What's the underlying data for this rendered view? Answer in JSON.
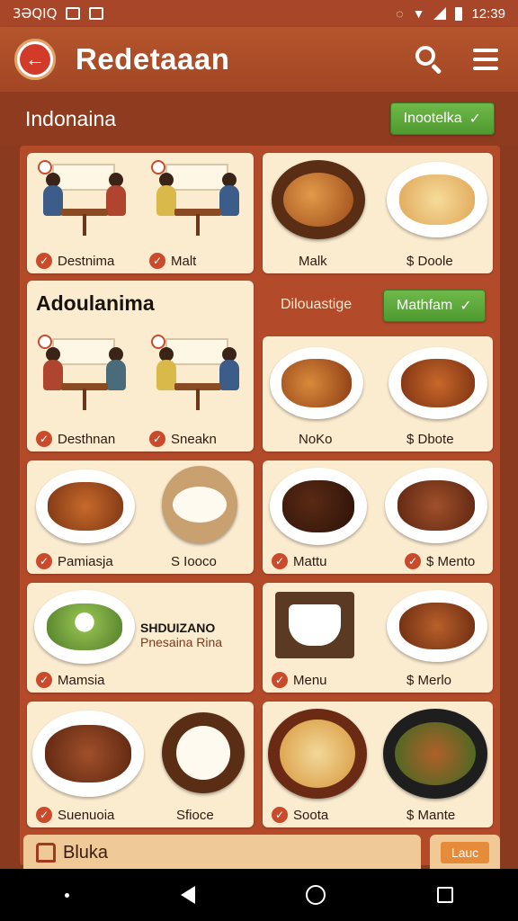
{
  "status_bar": {
    "left_text": "3ƏQIQ",
    "time": "12:39"
  },
  "app_bar": {
    "title": "Redetaaan"
  },
  "section": {
    "title": "Indonaina",
    "button_label": "Inootelka"
  },
  "cards": {
    "r1c1": {
      "left_label": "Destnima",
      "right_label": "Malt"
    },
    "r1c2": {
      "left_label": "Malk",
      "right_label": "$ Doole"
    },
    "feature": {
      "title": "Adoulanima",
      "left_label": "Desthnan",
      "right_label": "Sneakn"
    },
    "r2c2": {
      "side_label": "Dilouastige",
      "button_label": "Mathfam",
      "left_label": "NoKo",
      "right_label": "$ Dbote"
    },
    "r3c1": {
      "left_label": "Pamiasja",
      "right_label": "S Iooco"
    },
    "r3c2": {
      "left_label": "Mattu",
      "right_label": "$ Mento"
    },
    "r4c1": {
      "line1": "SHDUIZANO",
      "line2": "Pnesaina Rina",
      "left_label": "Mamsia"
    },
    "r4c2": {
      "left_label": "Menu",
      "right_label": "$ Merlo"
    },
    "r5c1": {
      "left_label": "Suenuoia",
      "right_label": "Sfioce"
    },
    "r5c2": {
      "left_label": "Soota",
      "right_label": "$ Mante"
    }
  },
  "bottom": {
    "label": "Bluka",
    "button_label": "Lauc"
  },
  "colors": {
    "brand": "#a8462a",
    "accent_green": "#5aa83a",
    "card": "#fbecd0"
  }
}
